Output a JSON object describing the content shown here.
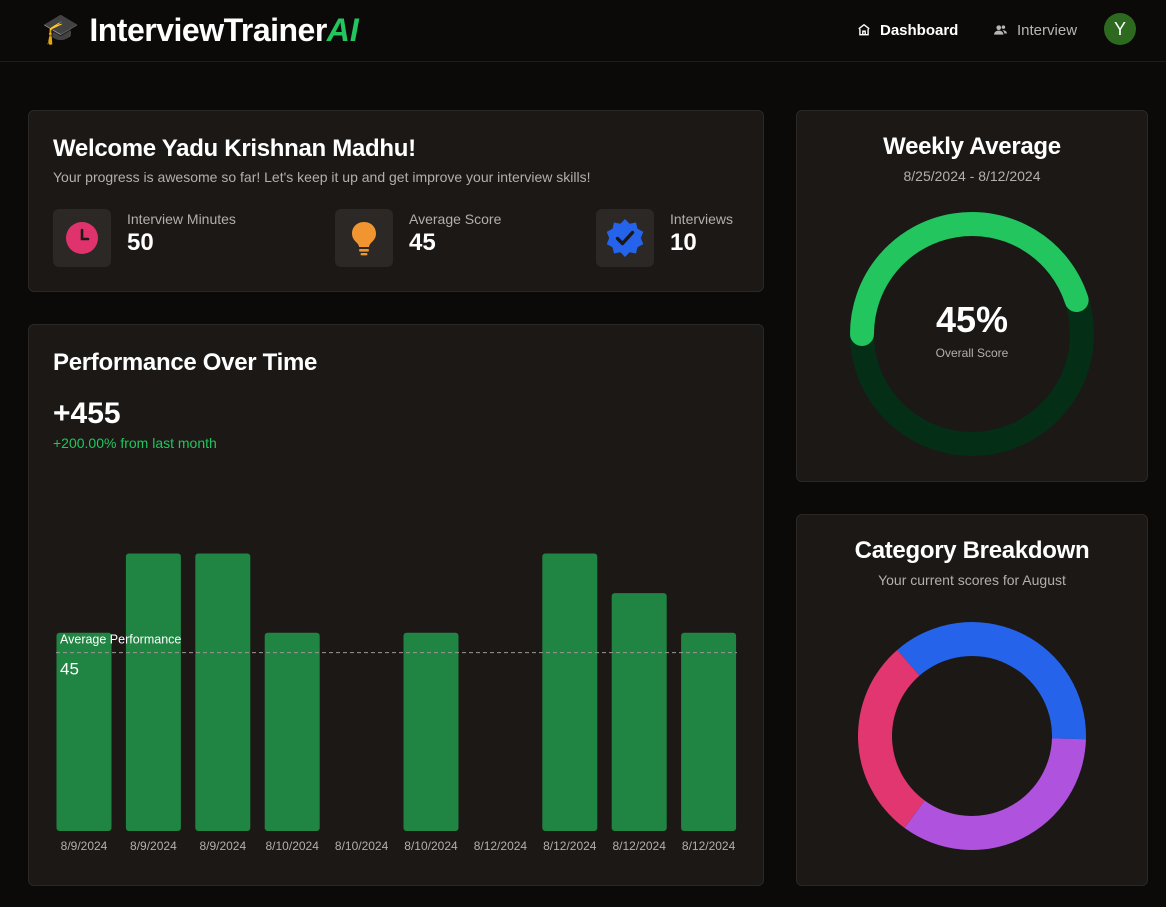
{
  "header": {
    "logo_icon": "🎓",
    "logo_text": "InterviewTrainer",
    "logo_ai": "AI",
    "nav": {
      "dashboard": "Dashboard",
      "interview": "Interview"
    },
    "avatar_initial": "Y"
  },
  "welcome": {
    "title": "Welcome Yadu Krishnan Madhu!",
    "subtitle": "Your progress is awesome so far! Let's keep it up and get improve your interview skills!",
    "stats": [
      {
        "label": "Interview Minutes",
        "value": "50",
        "icon": "clock-icon",
        "color": "#e0336d"
      },
      {
        "label": "Average Score",
        "value": "45",
        "icon": "lightbulb-icon",
        "color": "#f0952f"
      },
      {
        "label": "Interviews",
        "value": "10",
        "icon": "verified-badge-icon",
        "color": "#2563eb"
      }
    ]
  },
  "performance": {
    "title": "Performance Over Time",
    "value": "+455",
    "change": "+200.00% from last month",
    "reference_label": "Average Performance",
    "reference_value": "45"
  },
  "chart_data": {
    "type": "bar",
    "categories": [
      "8/9/2024",
      "8/9/2024",
      "8/9/2024",
      "8/10/2024",
      "8/10/2024",
      "8/10/2024",
      "8/12/2024",
      "8/12/2024",
      "8/12/2024",
      "8/12/2024"
    ],
    "values": [
      50,
      70,
      70,
      50,
      0,
      50,
      0,
      70,
      60,
      50
    ],
    "ylim": [
      0,
      85
    ],
    "reference_line": 45,
    "colors": {
      "bar": "#208442",
      "reference": "#9a9794"
    }
  },
  "weekly": {
    "title": "Weekly Average",
    "date_range": "8/25/2024 - 8/12/2024",
    "value_text": "45%",
    "value_label": "Overall Score",
    "fraction": 0.45,
    "colors": {
      "fill": "#22c55e",
      "track": "#052e16"
    }
  },
  "category": {
    "title": "Category Breakdown",
    "subtitle": "Your current scores for August",
    "segments": [
      {
        "color": "#2563eb",
        "fraction": 0.3685
      },
      {
        "color": "#af52de",
        "fraction": 0.3463
      },
      {
        "color": "#e13670",
        "fraction": 0.2852
      }
    ]
  }
}
